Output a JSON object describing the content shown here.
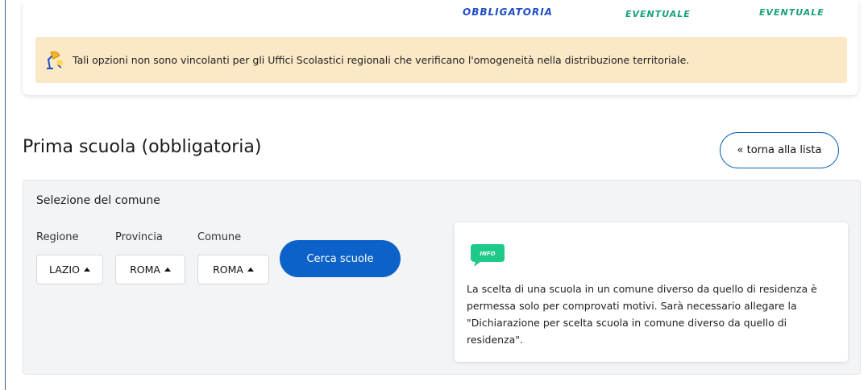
{
  "header": {
    "tags": [
      "OBBLIGATORIA",
      "EVENTUALE",
      "EVENTUALE"
    ]
  },
  "notice": {
    "icon": "desk-lamp-icon",
    "text": "Tali opzioni non sono vincolanti per gli Uffici Scolastici regionali che verificano l'omogeneità nella distribuzione territoriale."
  },
  "section": {
    "title": "Prima scuola (obbligatoria)",
    "back_label": "« torna alla lista"
  },
  "selection": {
    "title": "Selezione del comune",
    "fields": [
      {
        "label": "Regione",
        "value": "LAZIO"
      },
      {
        "label": "Provincia",
        "value": "ROMA"
      },
      {
        "label": "Comune",
        "value": "ROMA"
      }
    ],
    "search_label": "Cerca scuole"
  },
  "info": {
    "badge": "INFO",
    "text": "La scelta di una scuola in un comune diverso da quello di residenza è permessa solo per comprovati motivi. Sarà necessario allegare la \"Dichiarazione per scelta scuola in comune diverso da quello di residenza\"."
  },
  "colors": {
    "primary": "#0d62c9",
    "notice_bg": "#fbe8c6",
    "tag_blue": "#1f4fc4",
    "tag_green": "#18a07a",
    "info_green": "#1fc98a"
  }
}
